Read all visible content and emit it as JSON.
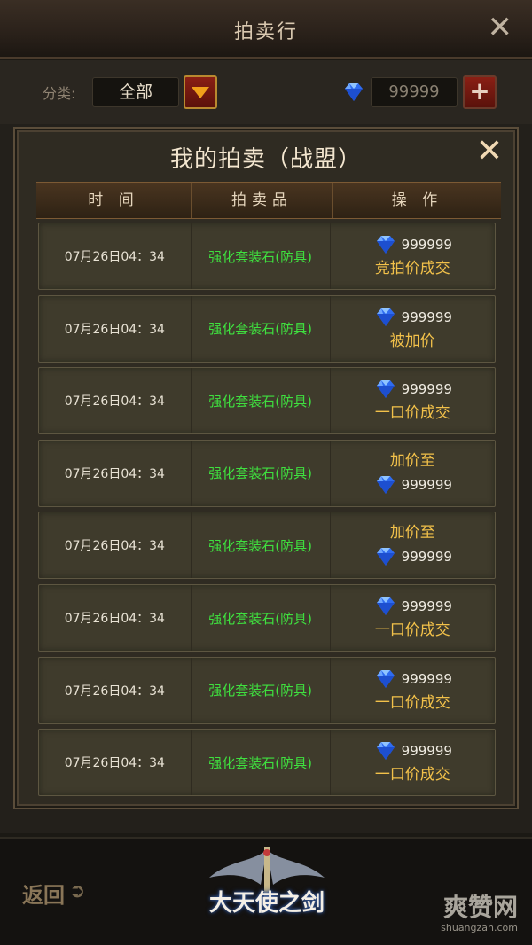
{
  "topbar": {
    "title": "拍卖行"
  },
  "filter": {
    "label": "分类:",
    "selected": "全部",
    "currency_value": "99999",
    "add_label": "+"
  },
  "panel": {
    "title": "我的拍卖（战盟）",
    "headers": [
      "时  间",
      "拍卖品",
      "操  作"
    ],
    "rows": [
      {
        "time": "07月26日04：34",
        "item": "强化套装石(防具)",
        "price": "999999",
        "status": "竞拍价成交",
        "order": "price-first"
      },
      {
        "time": "07月26日04：34",
        "item": "强化套装石(防具)",
        "price": "999999",
        "status": "被加价",
        "order": "price-first"
      },
      {
        "time": "07月26日04：34",
        "item": "强化套装石(防具)",
        "price": "999999",
        "status": "一口价成交",
        "order": "price-first"
      },
      {
        "time": "07月26日04：34",
        "item": "强化套装石(防具)",
        "price": "999999",
        "status": "加价至",
        "order": "status-first"
      },
      {
        "time": "07月26日04：34",
        "item": "强化套装石(防具)",
        "price": "999999",
        "status": "加价至",
        "order": "status-first"
      },
      {
        "time": "07月26日04：34",
        "item": "强化套装石(防具)",
        "price": "999999",
        "status": "一口价成交",
        "order": "price-first"
      },
      {
        "time": "07月26日04：34",
        "item": "强化套装石(防具)",
        "price": "999999",
        "status": "一口价成交",
        "order": "price-first"
      },
      {
        "time": "07月26日04：34",
        "item": "强化套装石(防具)",
        "price": "999999",
        "status": "一口价成交",
        "order": "price-first"
      }
    ]
  },
  "bottom": {
    "back_label": "返回",
    "logo_text": "大天使之剑",
    "watermark": "爽赞网",
    "watermark_url": "shuangzan.com"
  },
  "colors": {
    "item_green": "#3fe03f",
    "status_gold": "#f2c14a",
    "diamond_blue": "#3a7bff"
  },
  "icons": {
    "diamond": "diamond-icon",
    "close": "close-icon",
    "dropdown": "dropdown-triangle-icon",
    "add": "plus-icon",
    "back_arrow": "back-arrow-icon"
  }
}
